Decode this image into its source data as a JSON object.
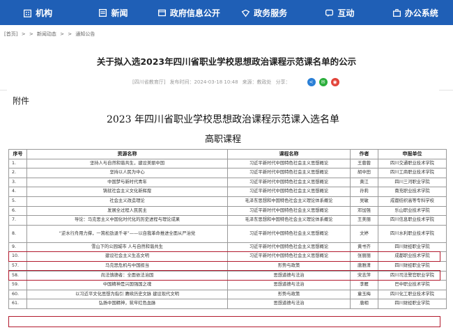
{
  "nav": {
    "items": [
      {
        "label": "机构",
        "icon": "building-icon"
      },
      {
        "label": "新闻",
        "icon": "news-icon"
      },
      {
        "label": "政府信息公开",
        "icon": "info-icon"
      },
      {
        "label": "政务服务",
        "icon": "service-icon"
      },
      {
        "label": "互动",
        "icon": "chat-icon"
      },
      {
        "label": "办公系统",
        "icon": "office-icon"
      }
    ],
    "color": "#1f5fb6"
  },
  "breadcrumb": [
    "[首页]",
    ">",
    ">",
    "新闻动态",
    ">",
    ">",
    "通知公告"
  ],
  "article": {
    "title": "关于拟入选2023年四川省职业学校思想政治课程示范课名单的公示",
    "source": "[四川省教育厅]",
    "published": "发布时间：2024-03-18 10:48",
    "from": "来源：教政处",
    "share": "分享："
  },
  "doc": {
    "annex": "附件",
    "title": "2023 年四川省职业学校思想政治课程示范课入选名单",
    "subtitle": "高职课程",
    "headers": [
      "序号",
      "资源名称",
      "课程名称",
      "作者",
      "申报单位"
    ],
    "rows": [
      {
        "no": "1.",
        "name": "坚持人与自然和谐共生，建设美丽中国",
        "course": "习近平新时代中国特色社会主义思想概论",
        "author": "王蓉蓉",
        "unit": "四川交通职业技术学院"
      },
      {
        "no": "2.",
        "name": "坚持以人民为中心",
        "course": "习近平新时代中国特色社会主义思想概论",
        "author": "胡中田",
        "unit": "四川工商职业技术学院"
      },
      {
        "no": "3.",
        "name": "中国梦与新时代青年",
        "course": "习近平新时代中国特色社会主义思想概论",
        "author": "黄江",
        "unit": "四川三河职业学院"
      },
      {
        "no": "4.",
        "name": "铸就社会主义文化新辉煌",
        "course": "习近平新时代中国特色社会主义思想概论",
        "author": "孙莉",
        "unit": "南充职业技术学院"
      },
      {
        "no": "5.",
        "name": "社会主义改造理论",
        "course": "毛泽东思想和中国特色社会主义理论体系概论",
        "author": "吴敏",
        "unit": "成都纺织高等专科学校"
      },
      {
        "no": "6.",
        "name": "发展全过程人民民主",
        "course": "习近平新时代中国特色社会主义思想概论",
        "author": "邓加强",
        "unit": "乐山职业技术学院"
      },
      {
        "no": "7.",
        "name": "导论：马克思主义中国化时代化的历史进程与理论成果",
        "course": "毛泽东思想和中国特色社会主义理论体系概论",
        "author": "王美丽",
        "unit": "四川信息职业技术学院"
      },
      {
        "no": "8.",
        "name": "“逆水行舟用力撑，一篙松劲退千寻”——以自我革命推进全面从严治党",
        "course": "习近平新时代中国特色社会主义思想概论",
        "author": "文婷",
        "unit": "四川水利职业技术学院",
        "tall": true
      },
      {
        "no": "9.",
        "name": "雪山下的公园城市 人与自然和谐共生",
        "course": "习近平新时代中国特色社会主义思想概论",
        "author": "黄书齐",
        "unit": "四川财经职业学院"
      },
      {
        "no": "10.",
        "name": "建设社会主义生态文明",
        "course": "习近平新时代中国特色社会主义思想概论",
        "author": "张丽丽",
        "unit": "成都职业技术学院"
      },
      {
        "no": "57.",
        "name": "马克思危机与中国担当",
        "course": "形势与政策",
        "author": "唐雅清",
        "unit": "四川财经职业学院"
      },
      {
        "no": "58.",
        "name": "尚法慎德者：全面依法治国",
        "course": "思想道德与法治",
        "author": "宋志萍",
        "unit": "四川司法警官职业学院"
      },
      {
        "no": "59.",
        "name": "中国精神是兴国强国之魂",
        "course": "思想道德与法治",
        "author": "李雁",
        "unit": "巴中职业技术学院"
      },
      {
        "no": "60.",
        "name": "以习近平文化思想为指引 赓续历史文脉 建设现代文明",
        "course": "形势与政策",
        "author": "童玉梅",
        "unit": "四川化工职业技术学院"
      },
      {
        "no": "61.",
        "name": "弘扬中国精神，筑牢红色血脉",
        "course": "思想道德与法治",
        "author": "唐相",
        "unit": "四川财经职业学院"
      }
    ]
  },
  "highlight_color": "#b2192d"
}
